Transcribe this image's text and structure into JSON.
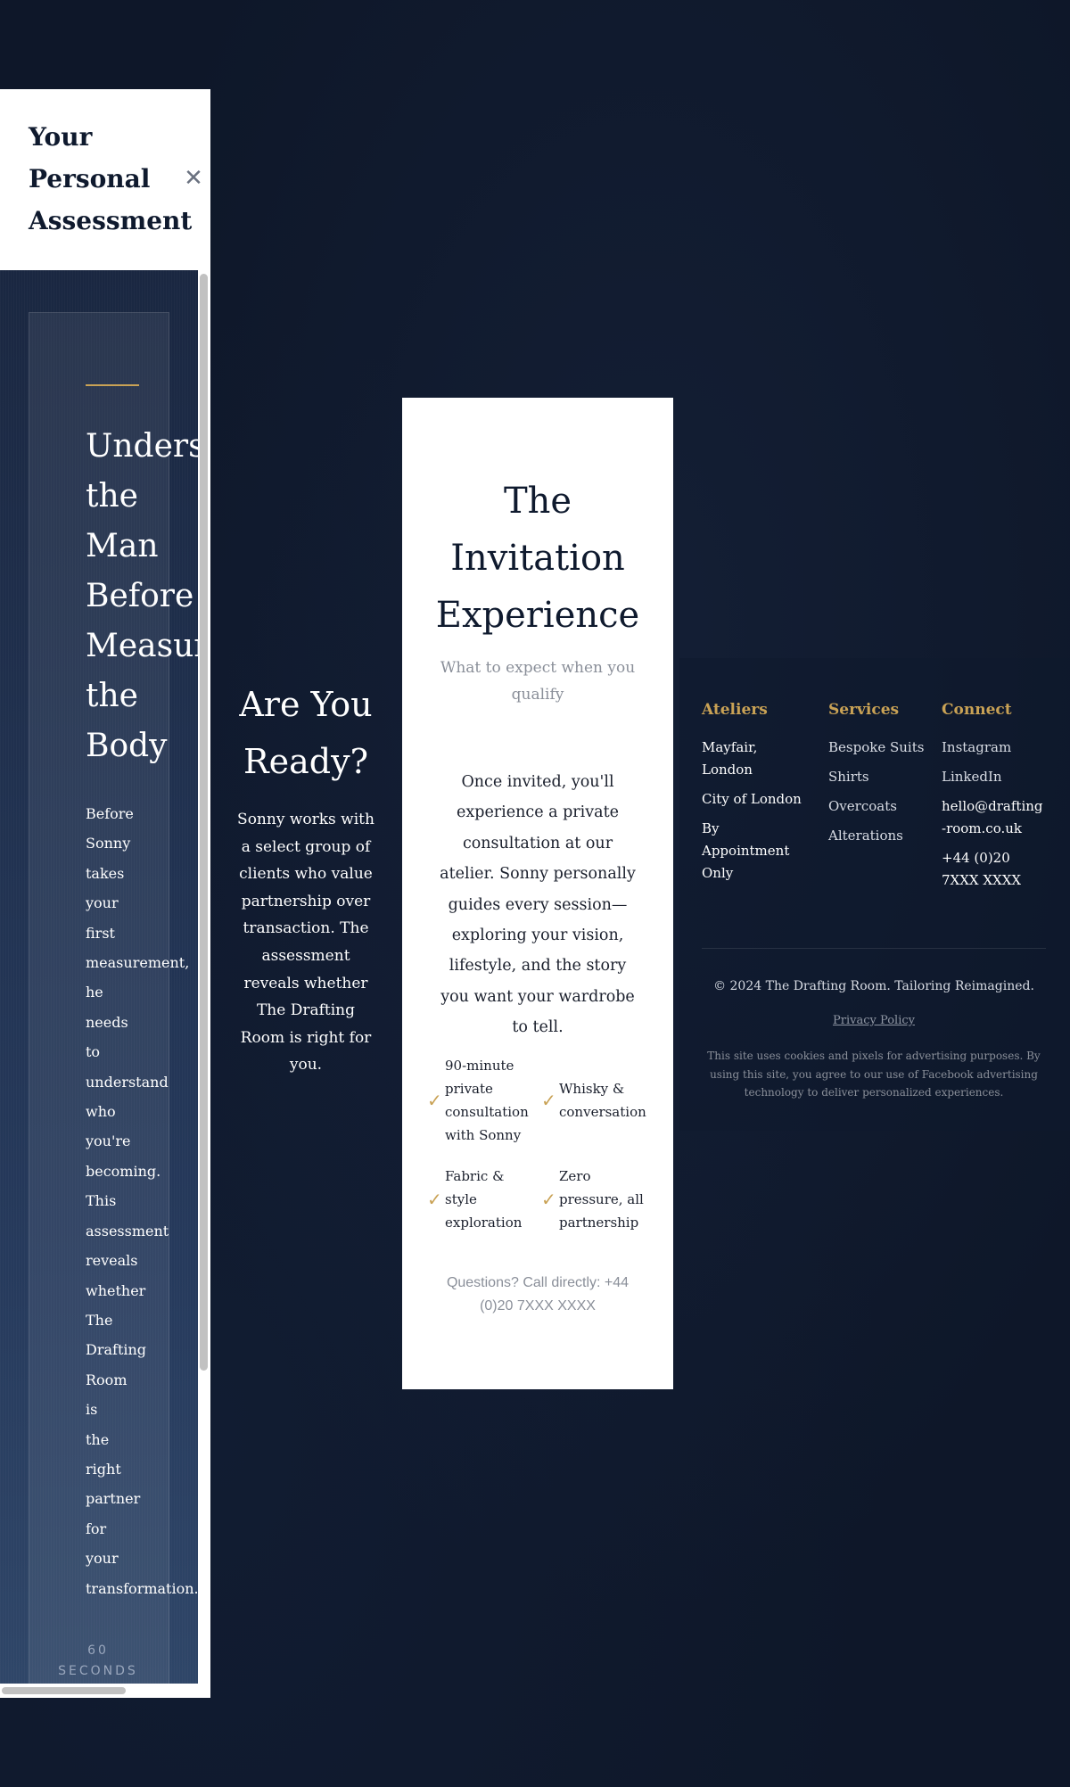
{
  "modal": {
    "title": "Your Personal Assessment",
    "close_icon": "✕",
    "card": {
      "heading": "Understanding\nthe\nMan\nBefore\nMeasuring\nthe\nBody",
      "text": "Before\nSonny\ntakes\nyour\nfirst\nmeasurement,\n he\nneeds\n to\nunderstand\nwho\nyou're\nbecoming.\nThis\nassessment\nreveals\nwhether\nThe\nDrafting\nRoom\n is\nthe\nright\npartner\n for\nyour\ntransformation.",
      "timer_number": "60",
      "timer_unit": "SECONDS"
    }
  },
  "ready": {
    "title": "Are You Ready?",
    "text": "Sonny works with a select group of clients who value partnership over transaction. The assessment reveals whether The Drafting Room is right for you."
  },
  "invitation": {
    "title": "The Invitation Experience",
    "subtitle": "What to expect when you qualify",
    "intro": "Once invited, you'll experience a private consultation at our atelier. Sonny personally guides every session—exploring your vision, lifestyle, and the story you want your wardrobe to tell.",
    "check_icon": "✓",
    "features": [
      "90-minute private consultation with Sonny",
      "Whisky & conversation",
      "Fabric & style exploration",
      "Zero pressure, all partnership"
    ],
    "call": "Questions? Call directly: +44 (0)20 7XXX XXXX"
  },
  "footer": {
    "ateliers": {
      "heading": "Ateliers",
      "items": [
        "Mayfair, London",
        "City of London",
        "By Appointment Only"
      ]
    },
    "services": {
      "heading": "Services",
      "items": [
        "Bespoke Suits",
        "Shirts",
        "Overcoats",
        "Alterations"
      ]
    },
    "connect": {
      "heading": "Connect",
      "items": [
        "Instagram",
        "LinkedIn",
        "hello@drafting-room.co.uk",
        "+44 (0)20 7XXX XXXX"
      ]
    },
    "copyright": "© 2024 The Drafting Room. Tailoring Reimagined.",
    "privacy": "Privacy Policy",
    "cookie": "This site uses cookies and pixels for advertising purposes. By using this site, you agree to our use of Facebook advertising technology to deliver personalized experiences."
  },
  "colors": {
    "background": "#0e1729",
    "accent_gold": "#c9a255",
    "panel_white": "#ffffff"
  }
}
